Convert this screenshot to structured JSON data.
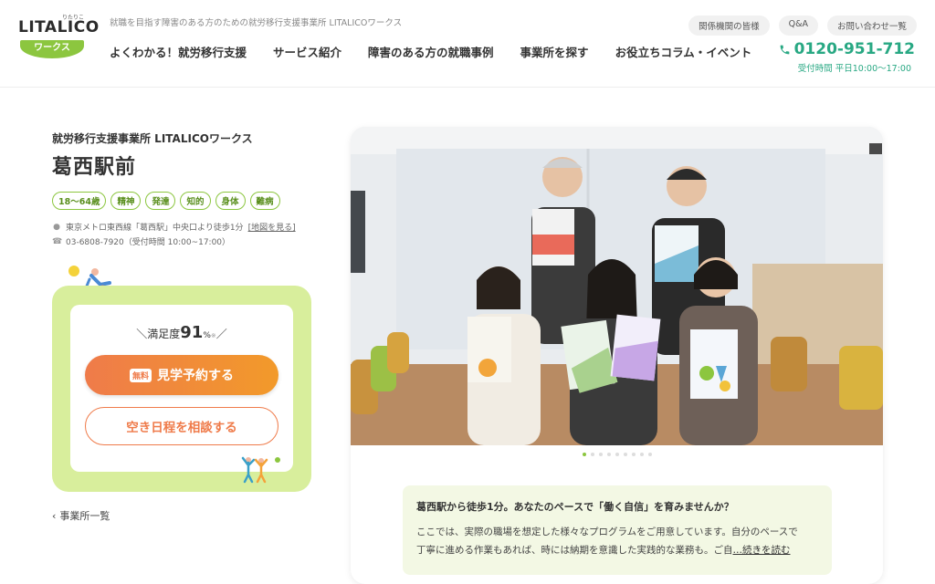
{
  "header": {
    "logo_word": "LITALICO",
    "logo_ruby": "りたりこ",
    "logo_badge": "ワークス",
    "tagline": "就職を目指す障害のある方のための就労移行支援事業所 LITALICOワークス",
    "nav": [
      "よくわかる！就労移行支援",
      "サービス紹介",
      "障害のある方の就職事例",
      "事業所を探す",
      "お役立ちコラム・イベント"
    ],
    "subnav": [
      "関係機関の皆様",
      "Q&A",
      "お問い合わせ一覧"
    ],
    "phone": "0120-951-712",
    "hours": "受付時間 平日10:00〜17:00"
  },
  "office": {
    "type": "就労移行支援事業所 LITALICOワークス",
    "name": "葛西駅前",
    "tags": [
      "18〜64歳",
      "精神",
      "発達",
      "知的",
      "身体",
      "難病"
    ],
    "address": "東京メトロ東西線「葛西駅」中央口より徒歩1分",
    "map_link": "[地図を見る]",
    "tel": "03-6808-7920（受付時間 10:00~17:00）"
  },
  "cta": {
    "sat_prefix": "＼満足度",
    "sat_value": "91",
    "sat_unit": "%",
    "sat_mark": "※",
    "sat_suffix": "／",
    "free_label": "無料",
    "visit_label": "見学予約する",
    "consult_label": "空き日程を相談する"
  },
  "back_link": "事業所一覧",
  "carousel": {
    "slide_count": 9,
    "active_index": 0
  },
  "description": {
    "title": "葛西駅から徒歩1分。あなたのペースで「働く自信」を育みませんか？",
    "line1": "ここでは、実際の職場を想定した様々なプログラムをご用意しています。自分のペースで",
    "line2": "丁寧に進める作業もあれば、時には納期を意識した実践的な業務も。ご自",
    "more": "…続きを読む"
  },
  "colors": {
    "brand_green": "#8cc63f",
    "phone_green": "#28a883",
    "cta_orange": "#ef7b4a",
    "cta_bg": "#d8ee9c"
  }
}
